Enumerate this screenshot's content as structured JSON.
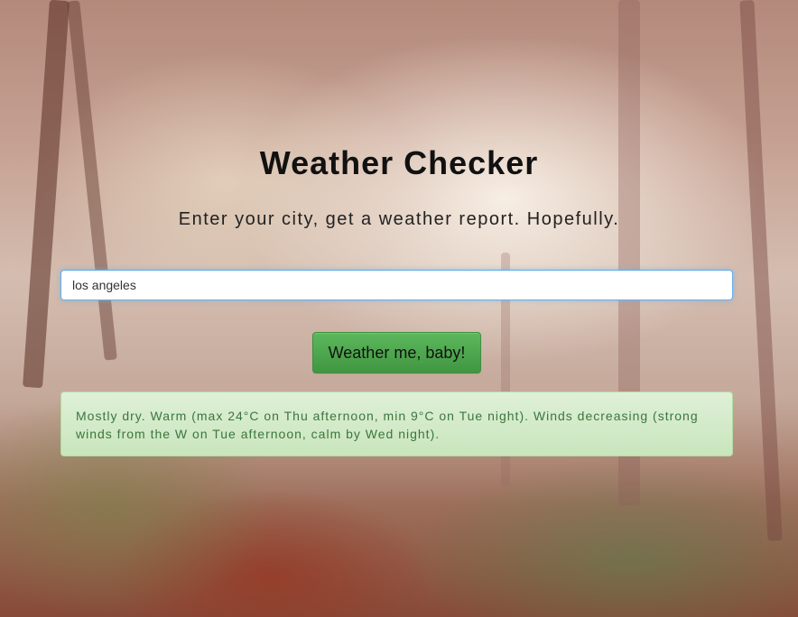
{
  "header": {
    "title": "Weather Checker",
    "subtitle": "Enter your city, get a weather report. Hopefully."
  },
  "form": {
    "city_value": "los angeles",
    "submit_label": "Weather me, baby!"
  },
  "result": {
    "message": "Mostly dry. Warm (max 24°C on Thu afternoon, min 9°C on Tue night). Winds decreasing (strong winds from the W on Tue afternoon, calm by Wed night)."
  },
  "colors": {
    "button_green": "#5cb85c",
    "alert_bg": "#dff0d8",
    "alert_text": "#3c763d",
    "input_focus": "#66afe9"
  }
}
